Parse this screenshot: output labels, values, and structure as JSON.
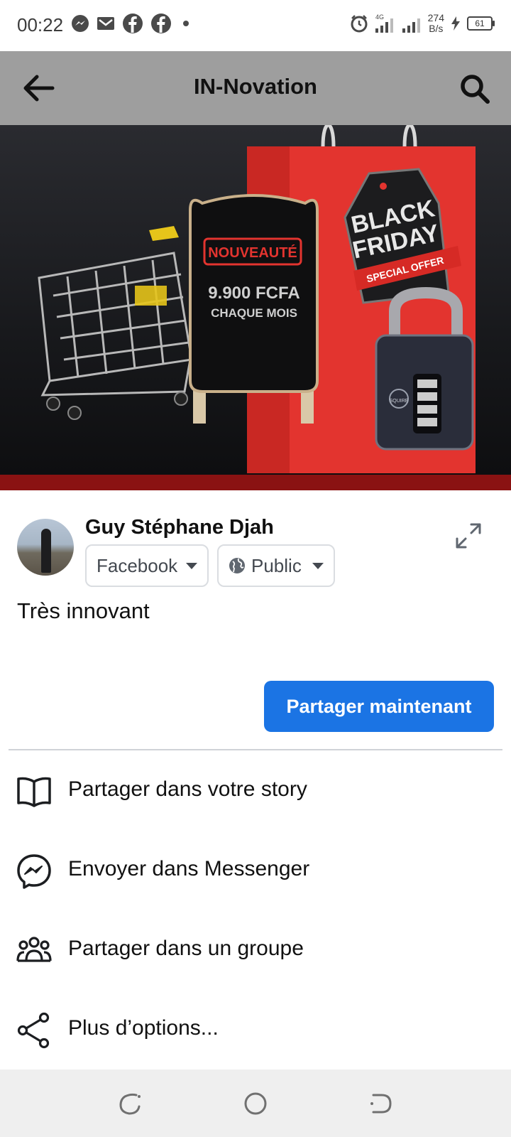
{
  "status_bar": {
    "time": "00:22",
    "network_type": "4G",
    "net_speed_value": "274",
    "net_speed_unit": "B/s",
    "battery": "61"
  },
  "header": {
    "title": "IN-Novation",
    "back_icon": "arrow-left-icon",
    "search_icon": "search-icon"
  },
  "hero": {
    "badge": "NOUVEAUTÉ",
    "price": "9.900 FCFA",
    "period": "CHAQUE MOIS",
    "tag_line1": "BLACK",
    "tag_line2": "FRIDAY",
    "tag_ribbon": "SPECIAL OFFER",
    "lock_brand": "SQUIRE"
  },
  "composer": {
    "user_name": "Guy Stéphane Djah",
    "destination": "Facebook",
    "audience": "Public",
    "text": "Très innovant",
    "share_button": "Partager maintenant"
  },
  "options": [
    {
      "label": "Partager dans votre story",
      "icon": "book-open-icon"
    },
    {
      "label": "Envoyer dans Messenger",
      "icon": "messenger-icon"
    },
    {
      "label": "Partager dans un groupe",
      "icon": "group-icon"
    },
    {
      "label": "Plus d’options...",
      "icon": "share-icon"
    }
  ],
  "colors": {
    "accent": "#1b74e4",
    "header_bg": "#9e9e9e",
    "nav_bg": "#efefef"
  }
}
